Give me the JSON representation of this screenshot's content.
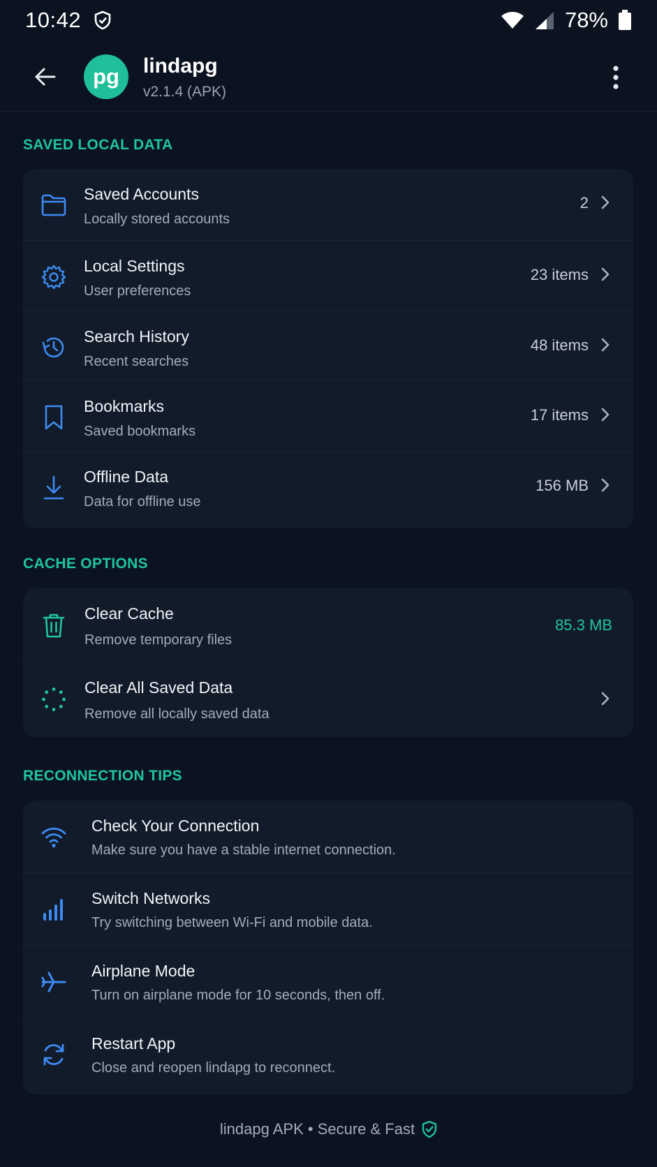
{
  "status_bar": {
    "time": "10:42",
    "battery": "78%"
  },
  "app_bar": {
    "avatar_initials": "pg",
    "title": "lindapg",
    "subtitle": "v2.1.4 (APK)"
  },
  "sections": {
    "saved_local_data": {
      "header": "SAVED LOCAL DATA",
      "items": [
        {
          "title": "Saved Accounts",
          "subtitle": "Locally stored accounts",
          "value": "2",
          "icon": "folder-icon"
        },
        {
          "title": "Local Settings",
          "subtitle": "User preferences",
          "value": "23 items",
          "icon": "gear-icon"
        },
        {
          "title": "Search History",
          "subtitle": "Recent searches",
          "value": "48 items",
          "icon": "history-icon"
        },
        {
          "title": "Bookmarks",
          "subtitle": "Saved bookmarks",
          "value": "17 items",
          "icon": "bookmark-icon"
        },
        {
          "title": "Offline Data",
          "subtitle": "Data for offline use",
          "value": "156 MB",
          "icon": "download-icon"
        }
      ]
    },
    "cache_options": {
      "header": "CACHE OPTIONS",
      "items": [
        {
          "title": "Clear Cache",
          "subtitle": "Remove temporary files",
          "value": "85.3 MB",
          "icon": "trash-icon"
        },
        {
          "title": "Clear All Saved Data",
          "subtitle": "Remove all locally saved data",
          "value": "",
          "icon": "dotted-circle-icon"
        }
      ]
    },
    "reconnection_tips": {
      "header": "RECONNECTION TIPS",
      "items": [
        {
          "title": "Check Your Connection",
          "subtitle": "Make sure you have a stable internet connection.",
          "icon": "wifi-icon"
        },
        {
          "title": "Switch Networks",
          "subtitle": "Try switching between Wi-Fi and mobile data.",
          "icon": "signal-bars-icon"
        },
        {
          "title": "Airplane Mode",
          "subtitle": "Turn on airplane mode for 10 seconds, then off.",
          "icon": "airplane-icon"
        },
        {
          "title": "Restart App",
          "subtitle": "Close and reopen lindapg to reconnect.",
          "icon": "refresh-icon"
        }
      ]
    }
  },
  "footer": {
    "text": "lindapg APK • Secure & Fast",
    "icon": "shield-check-icon"
  },
  "colors": {
    "background": "#0b1220",
    "card": "#121b2a",
    "accent": "#20c4a1",
    "icon_blue": "#3d8bf2",
    "avatar": "#1fbf9a"
  }
}
